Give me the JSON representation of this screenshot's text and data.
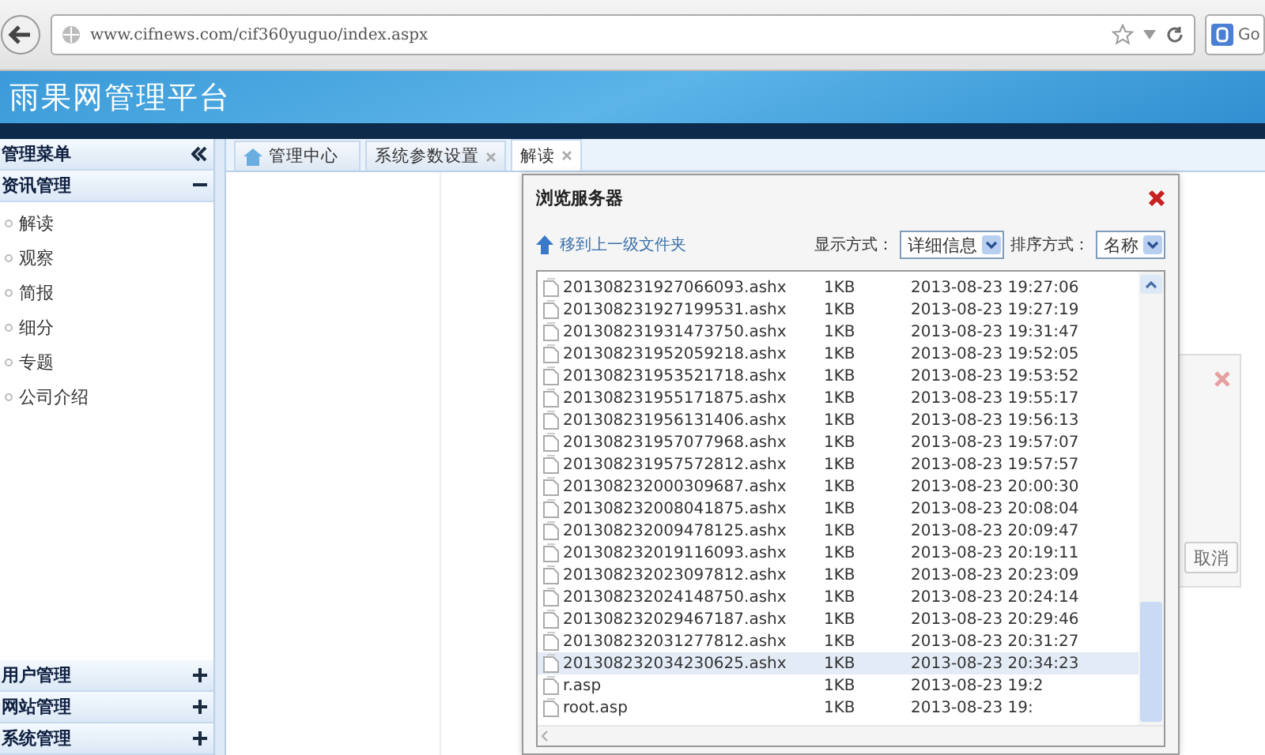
{
  "browser": {
    "url": "www.cifnews.com/cif360yuguo/index.aspx",
    "search_text": "Go"
  },
  "header": {
    "title": "雨果网管理平台"
  },
  "sidebar": {
    "title": "管理菜单",
    "sections": [
      {
        "title": "资讯管理",
        "expanded": true,
        "items": [
          "解读",
          "观察",
          "简报",
          "细分",
          "专题",
          "公司介绍"
        ]
      },
      {
        "title": "用户管理",
        "expanded": false
      },
      {
        "title": "网站管理",
        "expanded": false
      },
      {
        "title": "系统管理",
        "expanded": false
      }
    ]
  },
  "tabs": [
    {
      "label": "管理中心",
      "selected": false,
      "closable": false
    },
    {
      "label": "系统参数设置",
      "selected": false,
      "closable": true
    },
    {
      "label": "解读",
      "selected": true,
      "closable": true
    }
  ],
  "back_dialog": {
    "button": "取消"
  },
  "dialog": {
    "title": "浏览服务器",
    "up_link": "移到上一级文件夹",
    "view_label": "显示方式：",
    "view_value": "详细信息",
    "sort_label": "排序方式：",
    "sort_value": "名称",
    "files": [
      {
        "name": "201308231927066093.ashx",
        "size": "1KB",
        "date": "2013-08-23 19:27:06",
        "selected": false
      },
      {
        "name": "201308231927199531.ashx",
        "size": "1KB",
        "date": "2013-08-23 19:27:19",
        "selected": false
      },
      {
        "name": "201308231931473750.ashx",
        "size": "1KB",
        "date": "2013-08-23 19:31:47",
        "selected": false
      },
      {
        "name": "201308231952059218.ashx",
        "size": "1KB",
        "date": "2013-08-23 19:52:05",
        "selected": false
      },
      {
        "name": "201308231953521718.ashx",
        "size": "1KB",
        "date": "2013-08-23 19:53:52",
        "selected": false
      },
      {
        "name": "201308231955171875.ashx",
        "size": "1KB",
        "date": "2013-08-23 19:55:17",
        "selected": false
      },
      {
        "name": "201308231956131406.ashx",
        "size": "1KB",
        "date": "2013-08-23 19:56:13",
        "selected": false
      },
      {
        "name": "201308231957077968.ashx",
        "size": "1KB",
        "date": "2013-08-23 19:57:07",
        "selected": false
      },
      {
        "name": "201308231957572812.ashx",
        "size": "1KB",
        "date": "2013-08-23 19:57:57",
        "selected": false
      },
      {
        "name": "201308232000309687.ashx",
        "size": "1KB",
        "date": "2013-08-23 20:00:30",
        "selected": false
      },
      {
        "name": "201308232008041875.ashx",
        "size": "1KB",
        "date": "2013-08-23 20:08:04",
        "selected": false
      },
      {
        "name": "201308232009478125.ashx",
        "size": "1KB",
        "date": "2013-08-23 20:09:47",
        "selected": false
      },
      {
        "name": "201308232019116093.ashx",
        "size": "1KB",
        "date": "2013-08-23 20:19:11",
        "selected": false
      },
      {
        "name": "201308232023097812.ashx",
        "size": "1KB",
        "date": "2013-08-23 20:23:09",
        "selected": false
      },
      {
        "name": "201308232024148750.ashx",
        "size": "1KB",
        "date": "2013-08-23 20:24:14",
        "selected": false
      },
      {
        "name": "201308232029467187.ashx",
        "size": "1KB",
        "date": "2013-08-23 20:29:46",
        "selected": false
      },
      {
        "name": "201308232031277812.ashx",
        "size": "1KB",
        "date": "2013-08-23 20:31:27",
        "selected": false
      },
      {
        "name": "201308232034230625.ashx",
        "size": "1KB",
        "date": "2013-08-23 20:34:23",
        "selected": true
      },
      {
        "name": "r.asp",
        "size": "1KB",
        "date": "2013-08-23 19:2",
        "selected": false
      },
      {
        "name": "root.asp",
        "size": "1KB",
        "date": "2013-08-23 19:",
        "selected": false
      }
    ]
  }
}
